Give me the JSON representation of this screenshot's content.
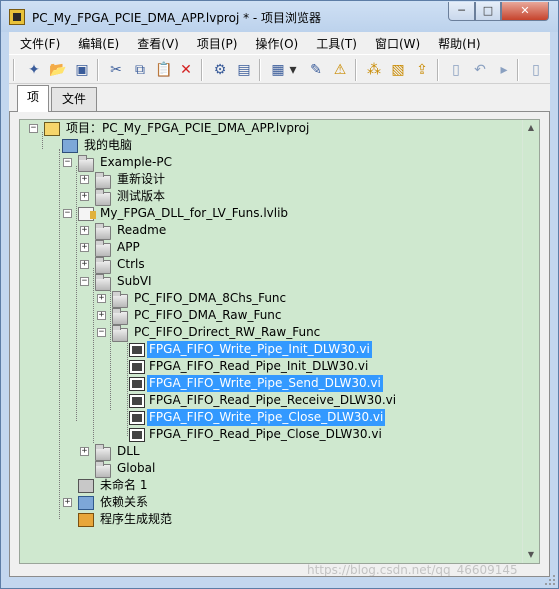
{
  "window": {
    "title": "PC_My_FPGA_PCIE_DMA_APP.lvproj * - 项目浏览器",
    "min_symbol": "─",
    "max_symbol": "□",
    "close_symbol": "✕"
  },
  "menu": {
    "items": [
      "文件(F)",
      "编辑(E)",
      "查看(V)",
      "项目(P)",
      "操作(O)",
      "工具(T)",
      "窗口(W)",
      "帮助(H)"
    ]
  },
  "toolbar": {
    "icons": [
      "new-icon",
      "open-icon",
      "save-all-icon",
      "cut-icon",
      "copy-icon",
      "paste-icon",
      "delete-icon",
      "properties-icon",
      "save-icon",
      "view-dropdown-icon",
      "chevron-down-icon",
      "wand-icon",
      "warning-icon",
      "build-icon",
      "filter-icon",
      "deploy-icon",
      "new-file-icon",
      "undo-icon",
      "add-icon",
      "add-item-icon"
    ],
    "glyphs": [
      "✦",
      "📂",
      "▣",
      "✂",
      "⧉",
      "📋",
      "✕",
      "⚙",
      "▤",
      "▦",
      "▾",
      "✎",
      "⚠",
      "⁂",
      "▧",
      "⇪",
      "▯",
      "↶",
      "▸",
      "▯"
    ]
  },
  "tabs": [
    "项",
    "文件"
  ],
  "tree": {
    "root": "项目：PC_My_FPGA_PCIE_DMA_APP.lvproj",
    "computer": "我的电脑",
    "example_pc": "Example-PC",
    "redesign": "重新设计",
    "test_version": "测试版本",
    "lib": "My_FPGA_DLL_for_LV_Funs.lvlib",
    "readme": "Readme",
    "app": "APP",
    "ctrls": "Ctrls",
    "subvi": "SubVI",
    "dma8": "PC_FIFO_DMA_8Chs_Func",
    "dma_raw": "PC_FIFO_DMA_Raw_Func",
    "direct_rw": "PC_FIFO_Drirect_RW_Raw_Func",
    "vis": [
      "FPGA_FIFO_Write_Pipe_Init_DLW30.vi",
      "FPGA_FIFO_Read_Pipe_Init_DLW30.vi",
      "FPGA_FIFO_Write_Pipe_Send_DLW30.vi",
      "FPGA_FIFO_Read_Pipe_Receive_DLW30.vi",
      "FPGA_FIFO_Write_Pipe_Close_DLW30.vi",
      "FPGA_FIFO_Read_Pipe_Close_DLW30.vi"
    ],
    "dll": "DLL",
    "global": "Global",
    "unnamed": "未命名 1",
    "dependencies": "依赖关系",
    "build_specs": "程序生成规范"
  },
  "colors": {
    "tree_bg": "#cfe8cf",
    "selection": "#3399ff"
  },
  "scrollbar": {
    "up_glyph": "▲",
    "down_glyph": "▼"
  },
  "watermark": "https://blog.csdn.net/qq_46609145"
}
